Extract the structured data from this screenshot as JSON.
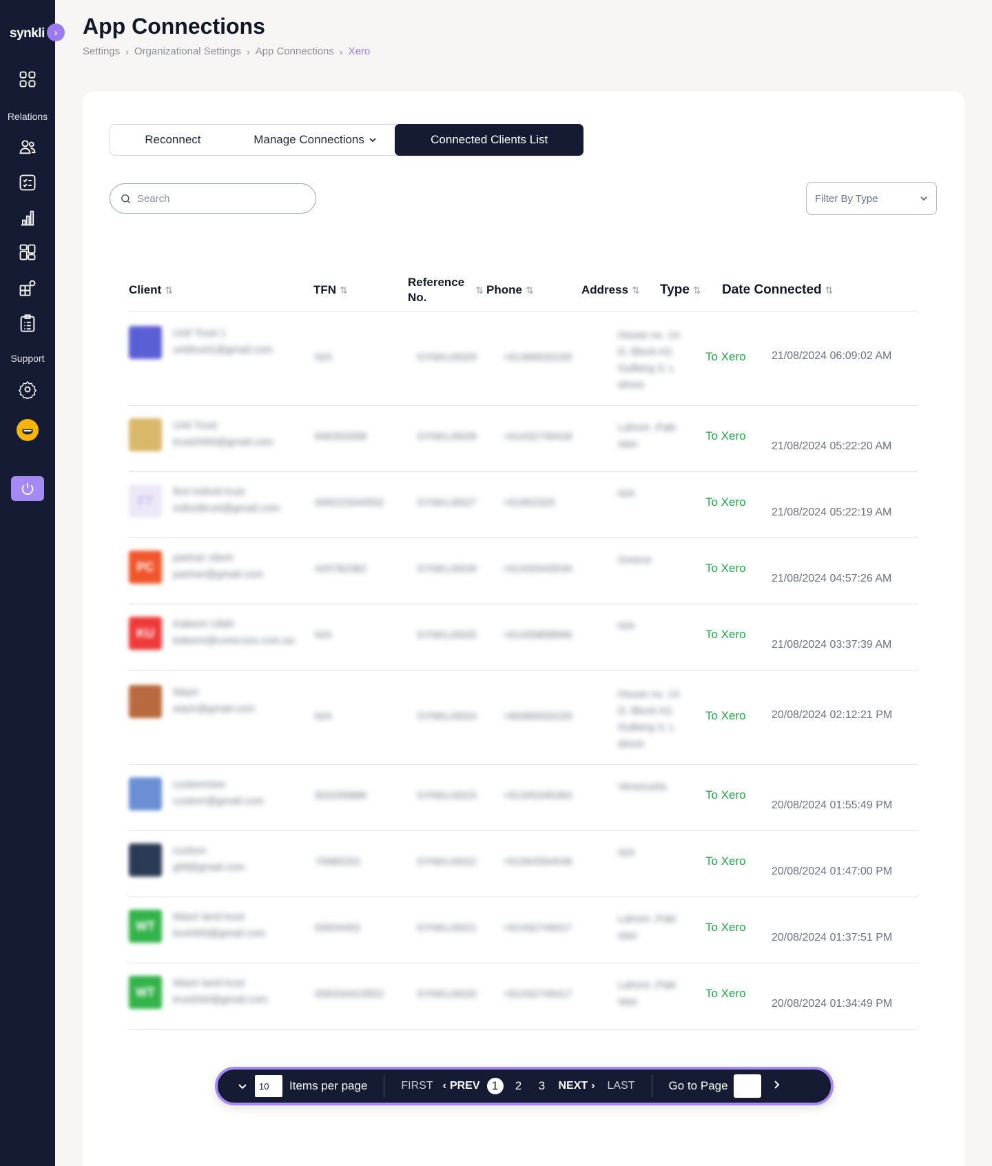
{
  "sidebar": {
    "logo": "synkli",
    "toggle_icon": "chevron-right-icon",
    "section_relations": "Relations",
    "section_support": "Support"
  },
  "header": {
    "title": "App Connections",
    "breadcrumb": [
      "Settings",
      "Organizational Settings",
      "App Connections",
      "Xero"
    ]
  },
  "tabs": {
    "reconnect": "Reconnect",
    "manage": "Manage Connections",
    "connected": "Connected Clients List"
  },
  "search": {
    "placeholder": "Search"
  },
  "filter": {
    "label": "Filter By Type"
  },
  "table": {
    "columns": {
      "client": "Client",
      "tfn": "TFN",
      "reference_line1": "Reference",
      "reference_line2": "No.",
      "phone": "Phone",
      "address": "Address",
      "type": "Type",
      "date": "Date Connected"
    },
    "rows": [
      {
        "initials": "",
        "name": "Unit Trust 1",
        "email": "unittrust1@gmail.com",
        "tfn": "N/A",
        "ref": "SYNKLI0029",
        "phone": "+61366632220",
        "address": "House no. 14 D, Block A2, Gulberg 3, L ahore",
        "type": "To Xero",
        "date": "21/08/2024 06:09:02 AM",
        "color": "#5b5fd6"
      },
      {
        "initials": "",
        "name": "Unit Trust",
        "email": "trust2000@gmail.com",
        "tfn": "846393358",
        "ref": "SYNKLI0028",
        "phone": "+61432749418",
        "address": "Lahore ,Paki stan",
        "type": "To Xero",
        "date": "21/08/2024 05:22:20 AM",
        "color": "#d9b86a"
      },
      {
        "initials": "FT",
        "name": "first individ trust",
        "email": "individtrust@gmail.com",
        "tfn": "009223344552",
        "ref": "SYNKLI0027",
        "phone": "+61952325",
        "address": "N/A",
        "type": "To Xero",
        "date": "21/08/2024 05:22:19 AM",
        "color": "#ece8f7"
      },
      {
        "initials": "PC",
        "name": "partner client",
        "email": "partner@gmail.com",
        "tfn": "425782382",
        "ref": "SYNKLI0026",
        "phone": "+61433443534",
        "address": "Greece",
        "type": "To Xero",
        "date": "21/08/2024 04:57:26 AM",
        "color": "#f0562b"
      },
      {
        "initials": "KU",
        "name": "Kaleem Ullah",
        "email": "kaleem@corecoss.com.au",
        "tfn": "N/A",
        "ref": "SYNKLI0025",
        "phone": "+61430858990",
        "address": "N/A",
        "type": "To Xero",
        "date": "21/08/2024 03:37:39 AM",
        "color": "#ef3a3a"
      },
      {
        "initials": "",
        "name": "Wazir",
        "email": "wazir@gmail.com",
        "tfn": "N/A",
        "ref": "SYNKLI0024",
        "phone": "+66366632220",
        "address": "House no. 14 D, Block A2, Gulberg 3, L ahore",
        "type": "To Xero",
        "date": "20/08/2024 02:12:21 PM",
        "color": "#b8693e"
      },
      {
        "initials": "",
        "name": "customnew",
        "email": "custom@gmail.com",
        "tfn": "903295886",
        "ref": "SYNKLI0023",
        "phone": "+61345345363",
        "address": "Venezuela",
        "type": "To Xero",
        "date": "20/08/2024 01:55:49 PM",
        "color": "#6a8fd4"
      },
      {
        "initials": "",
        "name": "custom",
        "email": "ghf@gmail.com",
        "tfn": "70985331",
        "ref": "SYNKLI0022",
        "phone": "+61564564546",
        "address": "N/A",
        "type": "To Xero",
        "date": "20/08/2024 01:47:00 PM",
        "color": "#2b3a55"
      },
      {
        "initials": "WT",
        "name": "Wazir land trust",
        "email": "tru4400@gmail.com",
        "tfn": "00934452",
        "ref": "SYNKLI0021",
        "phone": "+61432749417",
        "address": "Lahore ,Paki stan",
        "type": "To Xero",
        "date": "20/08/2024 01:37:51 PM",
        "color": "#34b34a"
      },
      {
        "initials": "WT",
        "name": "Wazir land trust",
        "email": "trust200@gmail.com",
        "tfn": "009334423552",
        "ref": "SYNKLI0020",
        "phone": "+61432749417",
        "address": "Lahore ,Paki stan",
        "type": "To Xero",
        "date": "20/08/2024 01:34:49 PM",
        "color": "#34b34a"
      }
    ]
  },
  "pagination": {
    "items_per_page_value": "10",
    "items_per_page_label": "Items per page",
    "first": "FIRST",
    "prev": "PREV",
    "pages": [
      "1",
      "2",
      "3"
    ],
    "current": "1",
    "next": "NEXT",
    "last": "LAST",
    "goto": "Go to Page"
  }
}
